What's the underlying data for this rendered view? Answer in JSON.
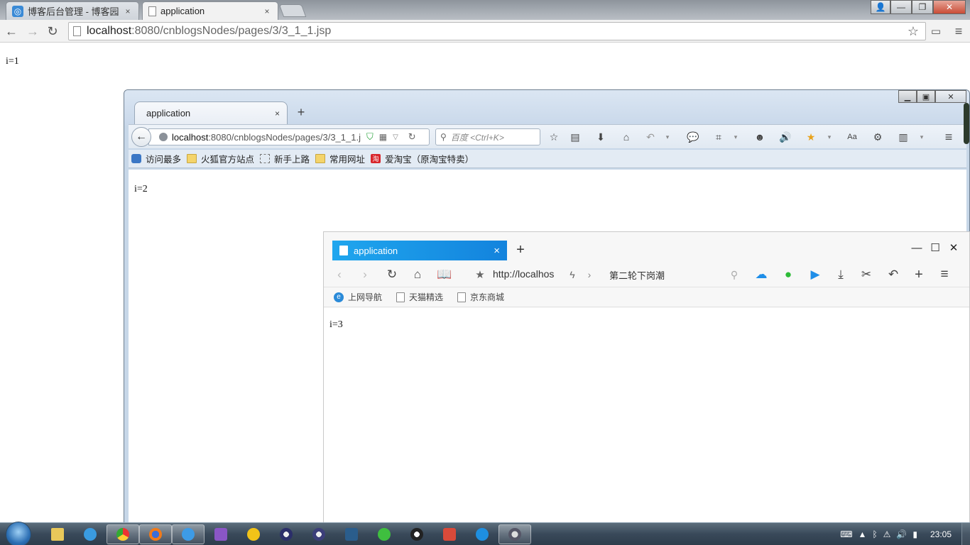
{
  "chrome": {
    "tabs": [
      {
        "label": "博客后台管理 - 博客园",
        "close": "×"
      },
      {
        "label": "application",
        "close": "×"
      }
    ],
    "controls": {
      "minimize": "—",
      "maximize": "❐",
      "close": "✕"
    },
    "url": {
      "host": "localhost",
      "rest": ":8080/cnblogsNodes/pages/3/3_1_1.jsp"
    },
    "content_text": "i=1"
  },
  "firefox": {
    "tab": {
      "label": "application",
      "close": "×"
    },
    "new_tab": "+",
    "url": {
      "host": "localhost",
      "rest": ":8080/cnblogsNodes/pages/3/3_1_1.j"
    },
    "search_placeholder": "百度 <Ctrl+K>",
    "bookmarks": [
      "访问最多",
      "火狐官方站点",
      "新手上路",
      "常用网址",
      "爱淘宝（原淘宝特卖）"
    ],
    "taobao_badge": "淘",
    "content_text": "i=2"
  },
  "sogou": {
    "tab": {
      "label": "application",
      "close": "×"
    },
    "new_tab": "+",
    "controls": {
      "minimize": "—",
      "maximize": "☐",
      "close": "✕"
    },
    "address": "http://localhos",
    "hot_search": "第二轮下岗潮",
    "bookmarks": [
      "上网导航",
      "天猫精选",
      "京东商城"
    ],
    "ie_badge": "e",
    "content_text": "i=3"
  },
  "taskbar": {
    "clock": "23:05"
  },
  "colors": {
    "sogou_tab": "#1383dd",
    "firefox_chrome": "#c7d7e8",
    "taskbar": "#39495a"
  }
}
